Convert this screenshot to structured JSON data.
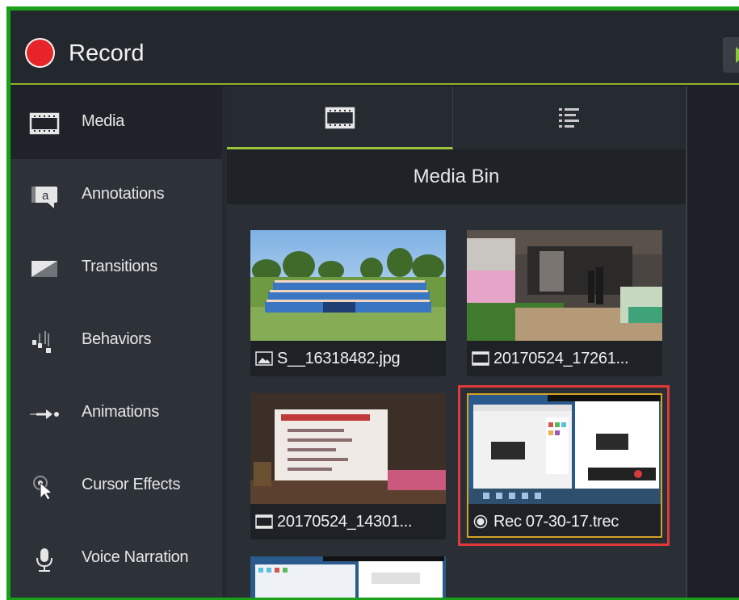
{
  "header": {
    "record_label": "Record"
  },
  "nav": {
    "items": [
      {
        "label": "Media",
        "icon": "film-strip-icon",
        "active": true
      },
      {
        "label": "Annotations",
        "icon": "annotation-callout-icon"
      },
      {
        "label": "Transitions",
        "icon": "transition-icon"
      },
      {
        "label": "Behaviors",
        "icon": "behaviors-icon"
      },
      {
        "label": "Animations",
        "icon": "animation-arrow-icon"
      },
      {
        "label": "Cursor Effects",
        "icon": "cursor-effects-icon"
      },
      {
        "label": "Voice Narration",
        "icon": "microphone-icon"
      }
    ]
  },
  "media_pane": {
    "tabs": [
      {
        "icon": "film-strip-icon",
        "active": true
      },
      {
        "icon": "list-view-icon",
        "active": false
      }
    ],
    "title": "Media Bin",
    "items": [
      {
        "name": "S__16318482.jpg",
        "type_icon": "image-icon"
      },
      {
        "name": "20170524_17261...",
        "type_icon": "film-strip-icon"
      },
      {
        "name": "20170524_14301...",
        "type_icon": "film-strip-icon"
      },
      {
        "name": "Rec 07-30-17.trec",
        "type_icon": "recording-icon",
        "selected": true
      },
      {
        "name": "",
        "type_icon": ""
      }
    ]
  },
  "colors": {
    "accent_green": "#9bc53d",
    "record_red": "#e8242b",
    "selection_red": "#e1393a",
    "selection_gold": "#d4a428",
    "window_border": "#19a019"
  }
}
